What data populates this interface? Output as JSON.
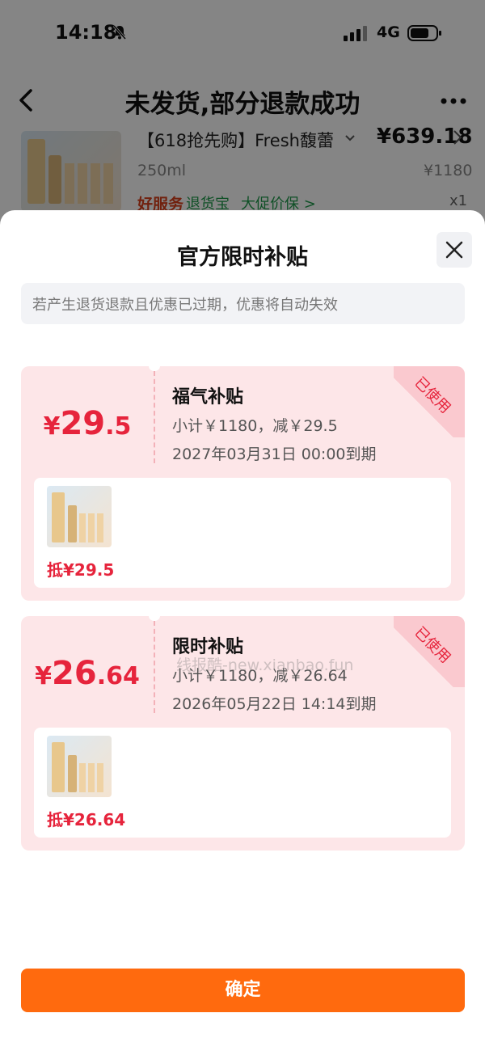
{
  "status_bar": {
    "time": "14:18",
    "network": "4G"
  },
  "nav": {
    "title": "未发货,部分退款成功"
  },
  "product": {
    "title": "【618抢先购】Fresh馥蕾",
    "price": "¥639.18",
    "spec": "250ml",
    "original_price": "¥1180",
    "good_service": "好服务",
    "service_1": "退货宝",
    "service_2": "大促价保 >",
    "quantity": "x1"
  },
  "sheet": {
    "title": "官方限时补贴",
    "notice": "若产生退货退款且优惠已过期，优惠将自动失效",
    "confirm_label": "确定"
  },
  "coupons": [
    {
      "amount_symbol": "¥",
      "amount_int": "29",
      "amount_dec": ".5",
      "name": "福气补贴",
      "detail": "小计￥1180，减￥29.5",
      "expire": "2027年03月31日 00:00到期",
      "status": "已使用",
      "deduct": "抵¥29.5"
    },
    {
      "amount_symbol": "¥",
      "amount_int": "26",
      "amount_dec": ".64",
      "name": "限时补贴",
      "detail": "小计￥1180，减￥26.64",
      "expire": "2026年05月22日 14:14到期",
      "status": "已使用",
      "deduct": "抵¥26.64"
    }
  ],
  "watermark": "线报酷-new.xianbao.fun",
  "colors": {
    "accent_red": "#e6243c",
    "confirm_orange": "#ff6a0e",
    "coupon_bg": "#fde6e8"
  }
}
